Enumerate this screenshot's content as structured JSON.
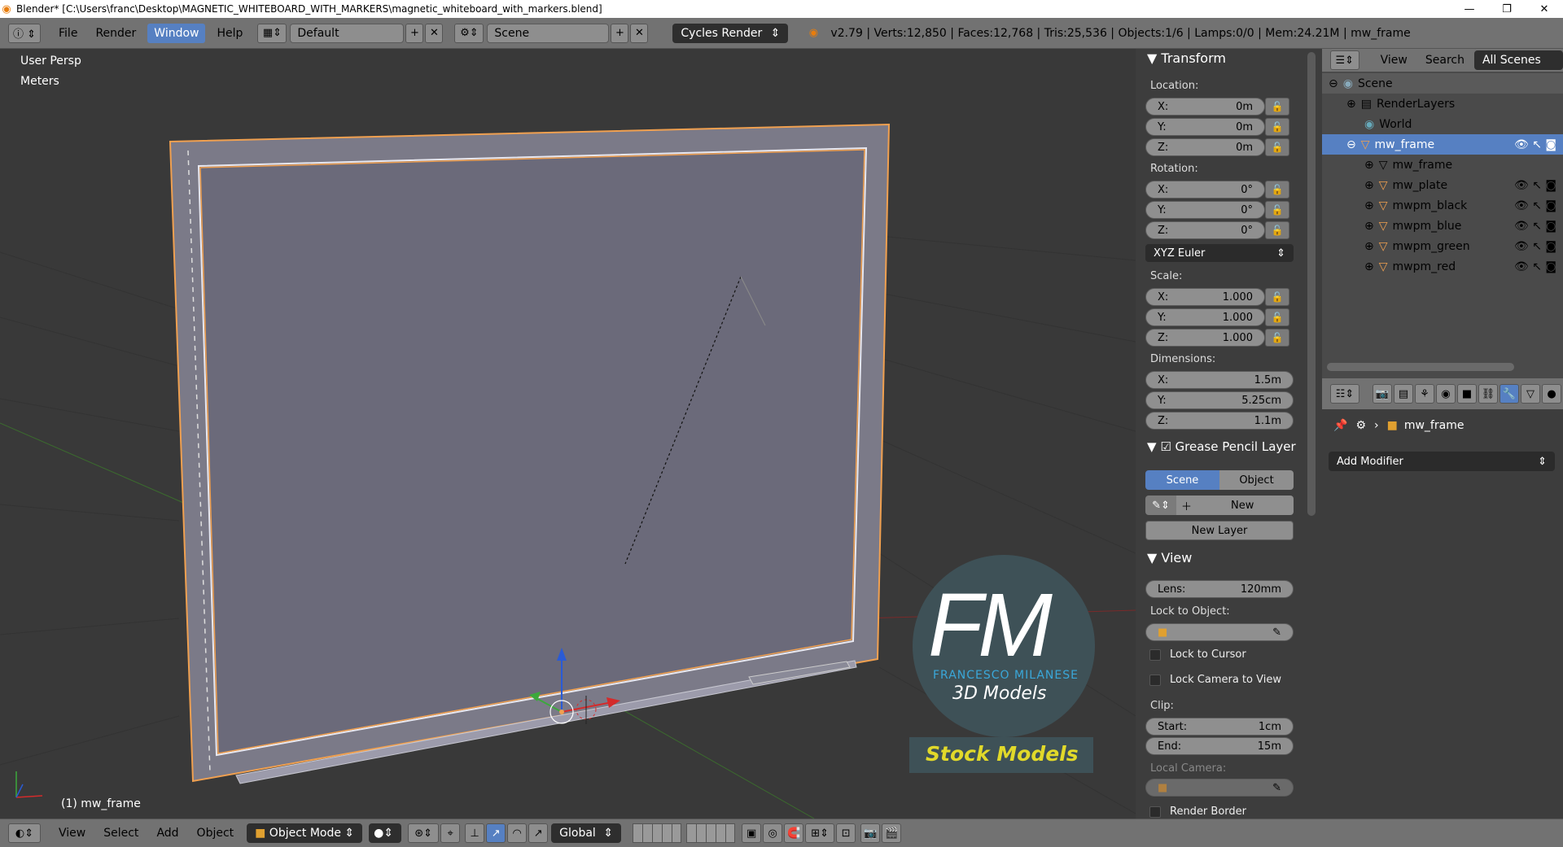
{
  "titlebar": {
    "title": "Blender* [C:\\Users\\franc\\Desktop\\MAGNETIC_WHITEBOARD_WITH_MARKERS\\magnetic_whiteboard_with_markers.blend]"
  },
  "info_header": {
    "menus": [
      "File",
      "Render",
      "Window",
      "Help"
    ],
    "screen_layout": "Default",
    "scene": "Scene",
    "engine": "Cycles Render",
    "stats": "v2.79 | Verts:12,850 | Faces:12,768 | Tris:25,536 | Objects:1/6 | Lamps:0/0 | Mem:24.21M | mw_frame"
  },
  "viewport": {
    "view_name": "User Persp",
    "units": "Meters",
    "active_object": "(1) mw_frame",
    "watermark": {
      "line1": "FM",
      "line2": "FRANCESCO MILANESE",
      "line3": "3D Models",
      "stock": "Stock Models"
    }
  },
  "npanel": {
    "transform": {
      "title": "Transform",
      "location_label": "Location:",
      "location": [
        {
          "axis": "X:",
          "value": "0m"
        },
        {
          "axis": "Y:",
          "value": "0m"
        },
        {
          "axis": "Z:",
          "value": "0m"
        }
      ],
      "rotation_label": "Rotation:",
      "rotation": [
        {
          "axis": "X:",
          "value": "0°"
        },
        {
          "axis": "Y:",
          "value": "0°"
        },
        {
          "axis": "Z:",
          "value": "0°"
        }
      ],
      "rotation_mode": "XYZ Euler",
      "scale_label": "Scale:",
      "scale": [
        {
          "axis": "X:",
          "value": "1.000"
        },
        {
          "axis": "Y:",
          "value": "1.000"
        },
        {
          "axis": "Z:",
          "value": "1.000"
        }
      ],
      "dimensions_label": "Dimensions:",
      "dimensions": [
        {
          "axis": "X:",
          "value": "1.5m"
        },
        {
          "axis": "Y:",
          "value": "5.25cm"
        },
        {
          "axis": "Z:",
          "value": "1.1m"
        }
      ]
    },
    "grease_pencil": {
      "title": "Grease Pencil Layer",
      "tab_scene": "Scene",
      "tab_object": "Object",
      "new_label": "New",
      "new_layer_label": "New Layer"
    },
    "view": {
      "title": "View",
      "lens_label": "Lens:",
      "lens_value": "120mm",
      "lock_to_object_label": "Lock to Object:",
      "lock_to_cursor": "Lock to Cursor",
      "lock_camera": "Lock Camera to View",
      "clip_label": "Clip:",
      "clip_start_label": "Start:",
      "clip_start": "1cm",
      "clip_end_label": "End:",
      "clip_end": "15m",
      "local_camera_label": "Local Camera:",
      "render_border": "Render Border"
    }
  },
  "outliner": {
    "menus": [
      "View",
      "Search"
    ],
    "filter": "All Scenes",
    "rows": [
      {
        "name": "Scene"
      },
      {
        "name": "RenderLayers"
      },
      {
        "name": "World"
      },
      {
        "name": "mw_frame"
      },
      {
        "name": "mw_frame"
      },
      {
        "name": "mw_plate"
      },
      {
        "name": "mwpm_black"
      },
      {
        "name": "mwpm_blue"
      },
      {
        "name": "mwpm_green"
      },
      {
        "name": "mwpm_red"
      }
    ]
  },
  "properties": {
    "object_name": "mw_frame",
    "add_modifier": "Add Modifier"
  },
  "bottom_header": {
    "menus": [
      "View",
      "Select",
      "Add",
      "Object"
    ],
    "mode": "Object Mode",
    "orientation": "Global"
  },
  "colors": {
    "selection_blue": "#5680c2",
    "active_orange": "#f0a050",
    "board_face": "#6b6a7a"
  }
}
